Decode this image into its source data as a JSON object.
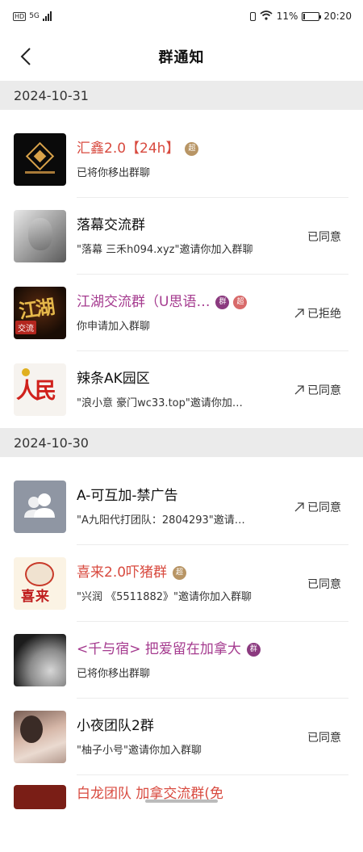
{
  "status_bar": {
    "network": "HD",
    "signal": "5G",
    "battery_percent": "11%",
    "time": "20:20",
    "battery_level": 0.11
  },
  "header": {
    "title": "群通知"
  },
  "sections": [
    {
      "date": "2024-10-31",
      "items": [
        {
          "name": "汇鑫2.0【24h】",
          "name_color": "#d84a3f",
          "badges": [
            {
              "text": "超",
              "color": "#b89565"
            }
          ],
          "desc": "已将你移出群聊",
          "status": "",
          "arrow": false
        },
        {
          "name": "落幕交流群",
          "name_color": "#111111",
          "badges": [],
          "desc": "\"落幕 三禾h094.xyz\"邀请你加入群聊",
          "status": "已同意",
          "arrow": false
        },
        {
          "name": "江湖交流群（U思语…",
          "name_color": "#a53b8f",
          "badges": [
            {
              "text": "群",
              "color": "#8b3a7f"
            },
            {
              "text": "超",
              "color": "#d86a6a"
            }
          ],
          "desc": "你申请加入群聊",
          "status": "已拒绝",
          "arrow": true
        },
        {
          "name": "辣条AK园区",
          "name_color": "#111111",
          "badges": [],
          "desc": "\"浪小意  豪门wc33.top\"邀请你加…",
          "status": "已同意",
          "arrow": true
        }
      ]
    },
    {
      "date": "2024-10-30",
      "items": [
        {
          "name": "A-可互加-禁广告",
          "name_color": "#111111",
          "badges": [],
          "desc": "\"A九阳代打团队：2804293\"邀请…",
          "status": "已同意",
          "arrow": true
        },
        {
          "name": "喜来2.0吓猪群",
          "name_color": "#d84a3f",
          "badges": [
            {
              "text": "超",
              "color": "#b89565"
            }
          ],
          "desc": "\"兴润 《5511882》\"邀请你加入群聊",
          "status": "已同意",
          "arrow": false
        },
        {
          "name": "<千与宿> 把爱留在加拿大",
          "name_color": "#a53b8f",
          "badges": [
            {
              "text": "群",
              "color": "#8b3a7f"
            }
          ],
          "desc": "已将你移出群聊",
          "status": "",
          "arrow": false
        },
        {
          "name": "小夜团队2群",
          "name_color": "#111111",
          "badges": [],
          "desc": "\"柚子小号\"邀请你加入群聊",
          "status": "已同意",
          "arrow": false
        },
        {
          "name": "白龙团队 加拿交流群(免",
          "name_color": "#d84a3f",
          "badges": [],
          "desc": "",
          "status": "",
          "arrow": false
        }
      ]
    }
  ],
  "avatar_labels": {
    "jianghu_main": "江湖",
    "jianghu_tag": "交流",
    "renmin": "人民",
    "xilai": "喜来"
  },
  "colors": {
    "section_bg": "#ebebeb",
    "red_name": "#d84a3f",
    "purple_name": "#a53b8f"
  }
}
